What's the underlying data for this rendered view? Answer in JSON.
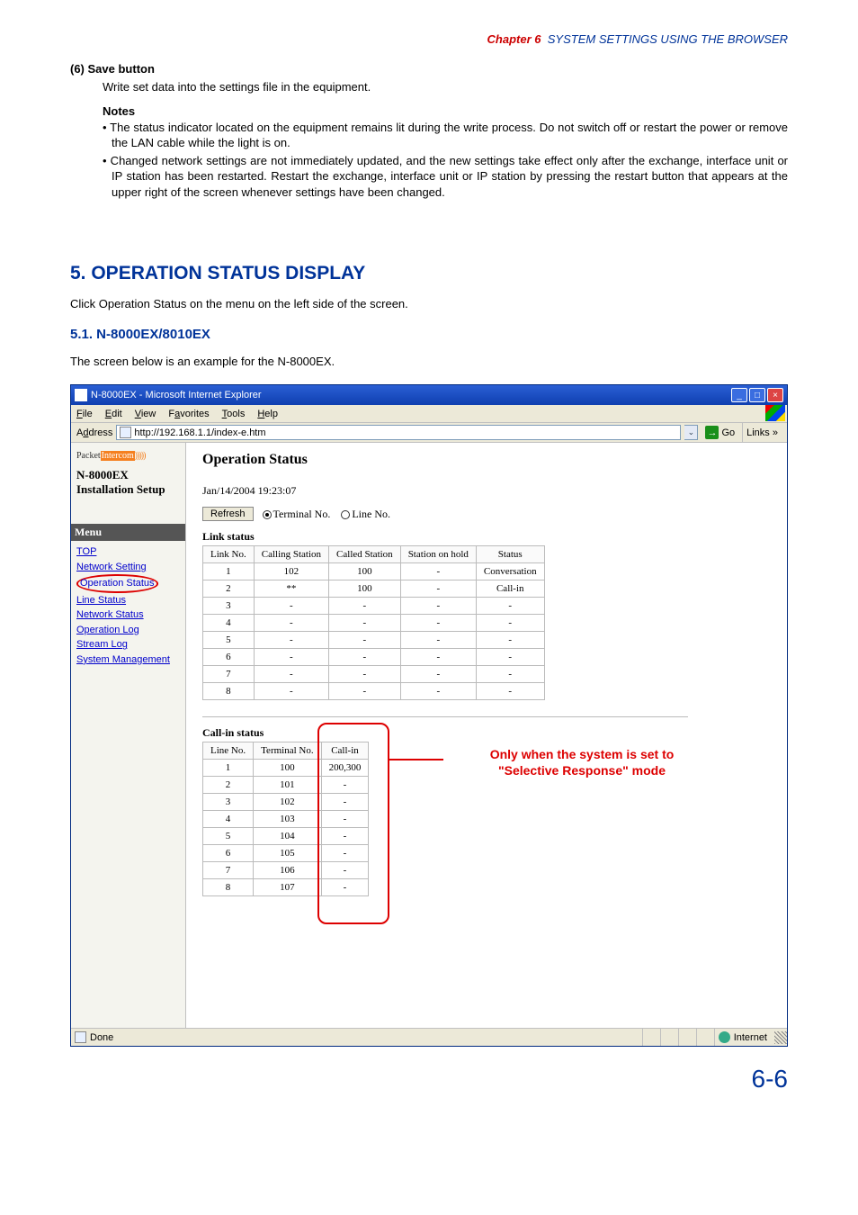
{
  "chapter": {
    "label": "Chapter 6",
    "title": "SYSTEM SETTINGS USING THE BROWSER"
  },
  "section6": {
    "num": "(6)",
    "title": "Save button",
    "desc": "Write set data into the settings file in the equipment.",
    "notes_hdr": "Notes",
    "note1": "• The status indicator located on the equipment remains lit during the write process. Do not switch off or restart the power or remove the LAN cable while the light is on.",
    "note2": "• Changed network settings are not immediately updated, and the new settings take effect only after the exchange, interface unit or IP station has been restarted. Restart the exchange, interface unit or IP station by pressing the restart button that appears at the upper right of the screen whenever settings have been changed."
  },
  "h2": "5. OPERATION STATUS DISPLAY",
  "h2_desc": "Click Operation Status on the menu on the left side of the screen.",
  "h3": "5.1. N-8000EX/8010EX",
  "h3_desc": "The screen below is an example for the N-8000EX.",
  "browser": {
    "title": "N-8000EX - Microsoft Internet Explorer",
    "menus": {
      "file": "File",
      "edit": "Edit",
      "view": "View",
      "fav": "Favorites",
      "tools": "Tools",
      "help": "Help"
    },
    "addr_label": "Address",
    "url": "http://192.168.1.1/index-e.htm",
    "go": "Go",
    "links": "Links",
    "statusbar": {
      "done": "Done",
      "zone": "Internet"
    }
  },
  "sidebar": {
    "logo_pk": "Packet",
    "logo_ic": "Intercom",
    "logo_wave": ")))))",
    "model": "N-8000EX",
    "inst": "Installation Setup",
    "menu_hdr": "Menu",
    "items": [
      "TOP",
      "Network Setting",
      "Operation Status",
      "Line Status",
      "Network Status",
      "Operation Log",
      "Stream Log",
      "System Management"
    ]
  },
  "main": {
    "title": "Operation Status",
    "timestamp": "Jan/14/2004 19:23:07",
    "refresh": "Refresh",
    "radio_terminal": "Terminal No.",
    "radio_line": "Line No.",
    "link_hdr": "Link status",
    "link_cols": [
      "Link No.",
      "Calling Station",
      "Called Station",
      "Station on hold",
      "Status"
    ],
    "link_rows": [
      {
        "n": "1",
        "a": "102",
        "b": "100",
        "c": "-",
        "d": "Conversation"
      },
      {
        "n": "2",
        "a": "**",
        "b": "100",
        "c": "-",
        "d": "Call-in"
      },
      {
        "n": "3",
        "a": "-",
        "b": "-",
        "c": "-",
        "d": "-"
      },
      {
        "n": "4",
        "a": "-",
        "b": "-",
        "c": "-",
        "d": "-"
      },
      {
        "n": "5",
        "a": "-",
        "b": "-",
        "c": "-",
        "d": "-"
      },
      {
        "n": "6",
        "a": "-",
        "b": "-",
        "c": "-",
        "d": "-"
      },
      {
        "n": "7",
        "a": "-",
        "b": "-",
        "c": "-",
        "d": "-"
      },
      {
        "n": "8",
        "a": "-",
        "b": "-",
        "c": "-",
        "d": "-"
      }
    ],
    "callin_hdr": "Call-in status",
    "callin_cols": [
      "Line No.",
      "Terminal No.",
      "Call-in"
    ],
    "callin_rows": [
      {
        "n": "1",
        "t": "100",
        "c": "200,300"
      },
      {
        "n": "2",
        "t": "101",
        "c": "-"
      },
      {
        "n": "3",
        "t": "102",
        "c": "-"
      },
      {
        "n": "4",
        "t": "103",
        "c": "-"
      },
      {
        "n": "5",
        "t": "104",
        "c": "-"
      },
      {
        "n": "6",
        "t": "105",
        "c": "-"
      },
      {
        "n": "7",
        "t": "106",
        "c": "-"
      },
      {
        "n": "8",
        "t": "107",
        "c": "-"
      }
    ],
    "red_note_l1": "Only when the system is set to",
    "red_note_l2": "\"Selective Response\" mode"
  },
  "pagenum": "6-6"
}
